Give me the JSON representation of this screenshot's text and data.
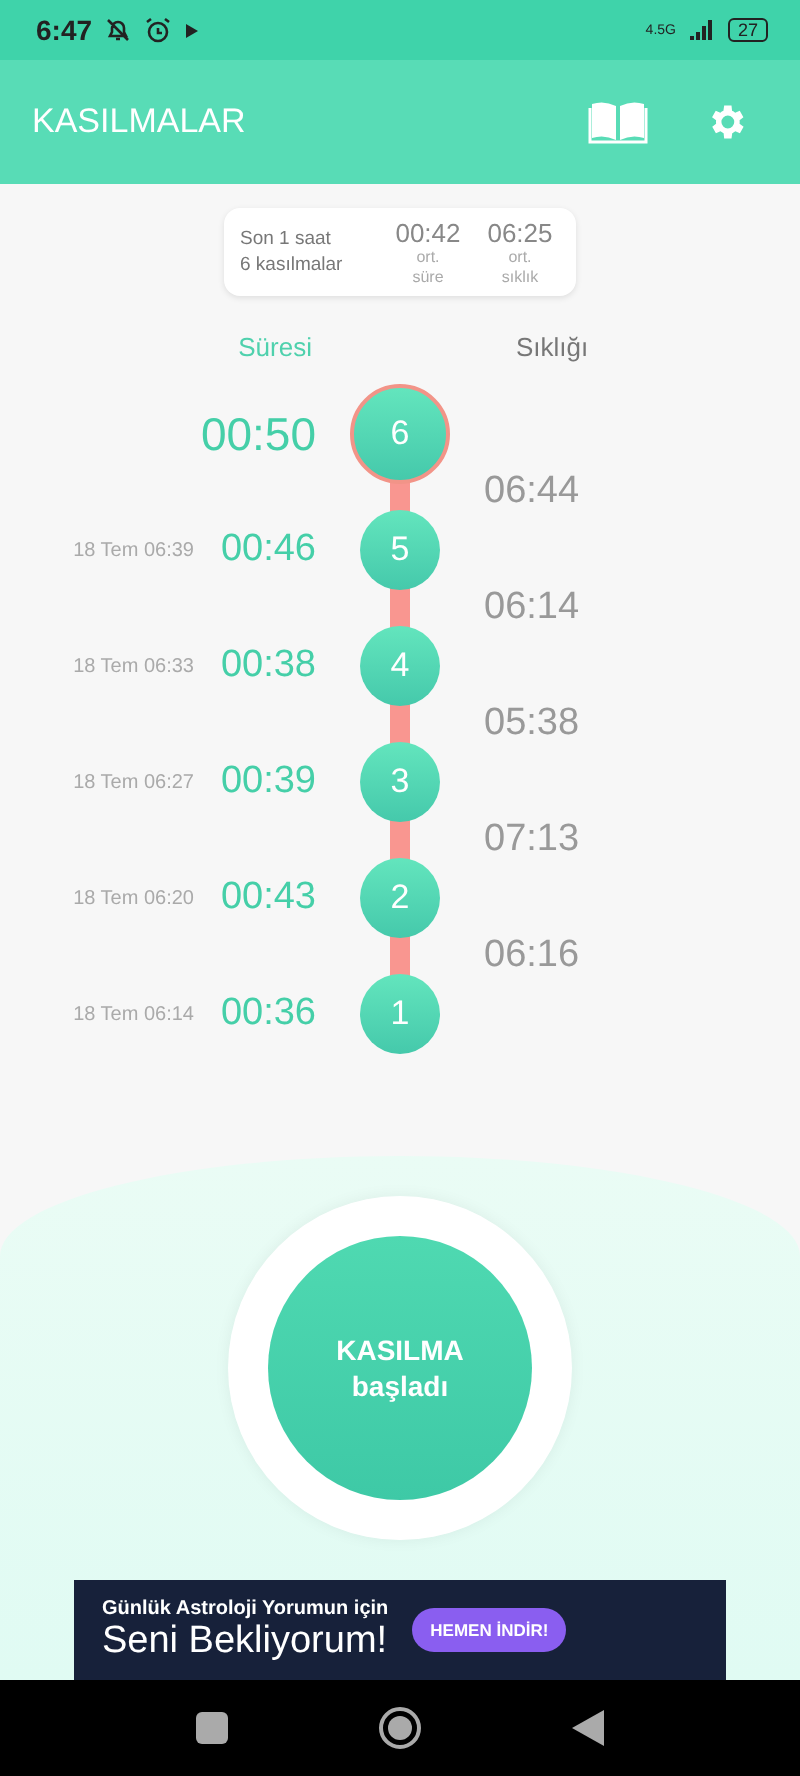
{
  "status_bar": {
    "time": "6:47",
    "network": "4.5G",
    "battery": "27"
  },
  "header": {
    "title": "KASILMALAR"
  },
  "summary": {
    "period": "Son 1 saat",
    "count": "6 kasılmalar",
    "stats": [
      {
        "value": "00:42",
        "label": "ort. süre"
      },
      {
        "value": "06:25",
        "label": "ort. sıklık"
      }
    ]
  },
  "columns": [
    {
      "label": "Süresi",
      "selected": true
    },
    {
      "label": "Sıklığı",
      "selected": false
    }
  ],
  "contractions": [
    {
      "number": "6",
      "duration": "00:50",
      "latest": true
    },
    {
      "number": "5",
      "date": "18 Tem 06:39",
      "duration": "00:46",
      "latest": false
    },
    {
      "number": "4",
      "date": "18 Tem 06:33",
      "duration": "00:38",
      "latest": false
    },
    {
      "number": "3",
      "date": "18 Tem 06:27",
      "duration": "00:39",
      "latest": false
    },
    {
      "number": "2",
      "date": "18 Tem 06:20",
      "duration": "00:43",
      "latest": false
    },
    {
      "number": "1",
      "date": "18 Tem 06:14",
      "duration": "00:36",
      "latest": false
    }
  ],
  "frequencies": [
    "06:44",
    "06:14",
    "05:38",
    "07:13",
    "06:16"
  ],
  "main_button": {
    "line1": "KASILMA",
    "line2": "başladı"
  },
  "ad": {
    "line1": "Günlük Astroloji Yorumun için",
    "line2": "Seni Bekliyorum!",
    "button": "HEMEN İNDİR!"
  }
}
